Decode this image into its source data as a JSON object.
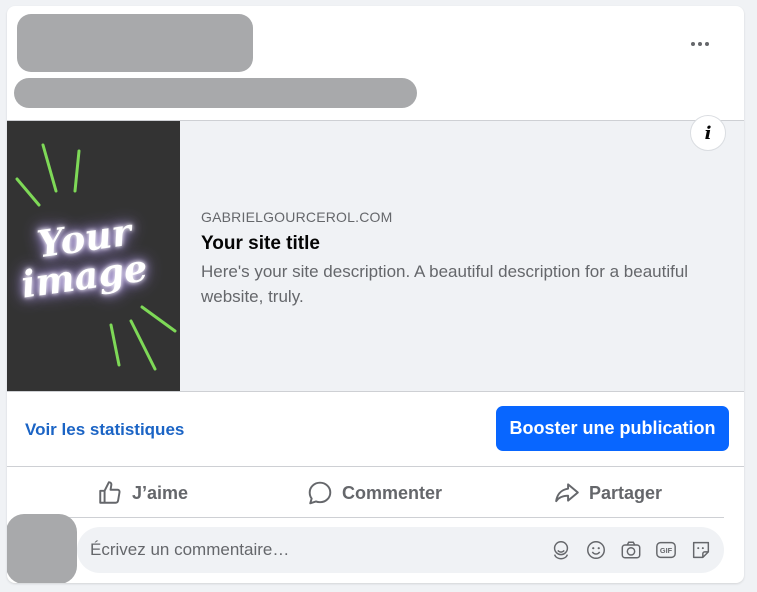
{
  "post": {
    "more_label": "More options"
  },
  "link_preview": {
    "image_text_line1": "Your",
    "image_text_line2": "image",
    "info_label": "i",
    "domain": "GABRIELGOURCEROL.COM",
    "title": "Your site title",
    "description": "Here's your site description. A beautiful description for a beautiful website, truly."
  },
  "actions_bar": {
    "stats_label": "Voir les statistiques",
    "boost_label": "Booster une publication"
  },
  "reactions": {
    "like_label": "J’aime",
    "comment_label": "Commenter",
    "share_label": "Partager"
  },
  "comment_box": {
    "placeholder": "Écrivez un commentaire…",
    "icons": [
      "avatar-sticker-icon",
      "emoji-icon",
      "camera-icon",
      "gif-icon",
      "sticker-icon"
    ],
    "gif_text": "GIF"
  },
  "colors": {
    "accent": "#0866ff",
    "link": "#1b64c5",
    "muted_text": "#65676b",
    "neon_green": "#7ed957"
  }
}
